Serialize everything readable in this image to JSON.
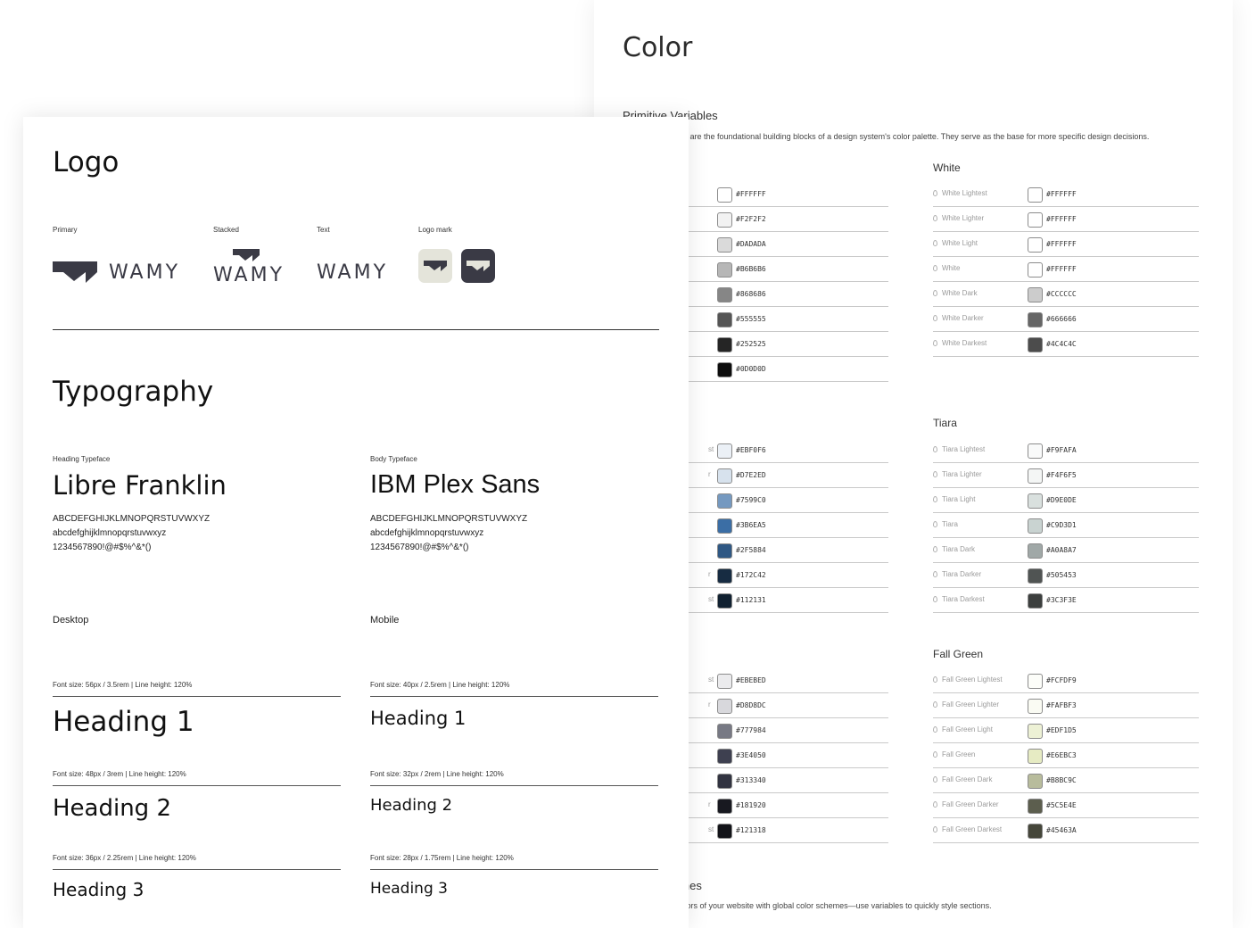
{
  "color_panel": {
    "title": "Color",
    "primitive_title": "Primitive Variables",
    "primitive_desc": "Primitive variables are the foundational building blocks of a design system's color palette. They serve as the base for more specific design decisions.",
    "schemes_title": "Color Schemes",
    "schemes_desc": "Customize the colors of your website with global color schemes—use variables to quickly style sections.",
    "left_groups": [
      {
        "rows": [
          {
            "name": "",
            "hex": "#FFFFFF"
          },
          {
            "name": "",
            "hex": "#F2F2F2"
          },
          {
            "name": "",
            "hex": "#DADADA"
          },
          {
            "name": "",
            "hex": "#B6B6B6"
          },
          {
            "name": "",
            "hex": "#868686"
          },
          {
            "name": "",
            "hex": "#555555"
          },
          {
            "name": "",
            "hex": "#252525"
          },
          {
            "name": "",
            "hex": "#0D0D0D"
          }
        ]
      },
      {
        "rows": [
          {
            "name": "st",
            "hex": "#EBF0F6"
          },
          {
            "name": "r",
            "hex": "#D7E2ED"
          },
          {
            "name": "",
            "hex": "#7599C0"
          },
          {
            "name": "",
            "hex": "#3B6EA5"
          },
          {
            "name": "",
            "hex": "#2F5884"
          },
          {
            "name": "r",
            "hex": "#172C42"
          },
          {
            "name": "st",
            "hex": "#112131"
          }
        ]
      },
      {
        "rows": [
          {
            "name": "st",
            "hex": "#EBEBED"
          },
          {
            "name": "r",
            "hex": "#D8D8DC"
          },
          {
            "name": "",
            "hex": "#777984"
          },
          {
            "name": "",
            "hex": "#3E4050"
          },
          {
            "name": "",
            "hex": "#313340"
          },
          {
            "name": "r",
            "hex": "#181920"
          },
          {
            "name": "st",
            "hex": "#121318"
          }
        ]
      }
    ],
    "right_groups": [
      {
        "title": "White",
        "rows": [
          {
            "name": "White Lightest",
            "hex": "#FFFFFF"
          },
          {
            "name": "White Lighter",
            "hex": "#FFFFFF"
          },
          {
            "name": "White Light",
            "hex": "#FFFFFF"
          },
          {
            "name": "White",
            "hex": "#FFFFFF"
          },
          {
            "name": "White Dark",
            "hex": "#CCCCCC"
          },
          {
            "name": "White Darker",
            "hex": "#666666"
          },
          {
            "name": "White Darkest",
            "hex": "#4C4C4C"
          }
        ]
      },
      {
        "title": "Tiara",
        "rows": [
          {
            "name": "Tiara Lightest",
            "hex": "#F9FAFA"
          },
          {
            "name": "Tiara Lighter",
            "hex": "#F4F6F5"
          },
          {
            "name": "Tiara Light",
            "hex": "#D9E0DE"
          },
          {
            "name": "Tiara",
            "hex": "#C9D3D1"
          },
          {
            "name": "Tiara Dark",
            "hex": "#A0A8A7"
          },
          {
            "name": "Tiara Darker",
            "hex": "#505453"
          },
          {
            "name": "Tiara Darkest",
            "hex": "#3C3F3E"
          }
        ]
      },
      {
        "title": "Fall Green",
        "rows": [
          {
            "name": "Fall Green Lightest",
            "hex": "#FCFDF9"
          },
          {
            "name": "Fall Green Lighter",
            "hex": "#FAFBF3"
          },
          {
            "name": "Fall Green Light",
            "hex": "#EDF1D5"
          },
          {
            "name": "Fall Green",
            "hex": "#E6EBC3"
          },
          {
            "name": "Fall Green Dark",
            "hex": "#B8BC9C"
          },
          {
            "name": "Fall Green Darker",
            "hex": "#5C5E4E"
          },
          {
            "name": "Fall Green Darkest",
            "hex": "#45463A"
          }
        ]
      }
    ]
  },
  "logo": {
    "title": "Logo",
    "primary_label": "Primary",
    "stacked_label": "Stacked",
    "text_label": "Text",
    "mark_label": "Logo mark",
    "wordmark": "WAMY",
    "mark_light_bg": "#E4E4DA",
    "mark_dark_bg": "#3A3A45",
    "brand_color": "#3A3A45"
  },
  "typography": {
    "title": "Typography",
    "heading_face_label": "Heading Typeface",
    "heading_face": "Libre Franklin",
    "body_face_label": "Body Typeface",
    "body_face": "IBM Plex Sans",
    "uppercase": "ABCDEFGHIJKLMNOPQRSTUVWXYZ",
    "lowercase": "abcdefghijklmnopqrstuvwxyz",
    "numbers": "1234567890!@#$%^&*()",
    "desktop": {
      "label": "Desktop",
      "h1_spec": "Font size: 56px / 3.5rem | Line height: 120%",
      "h1": "Heading 1",
      "h2_spec": "Font size: 48px / 3rem | Line height: 120%",
      "h2": "Heading 2",
      "h3_spec": "Font size: 36px / 2.25rem | Line height: 120%",
      "h3": "Heading 3"
    },
    "mobile": {
      "label": "Mobile",
      "h1_spec": "Font size: 40px / 2.5rem | Line height: 120%",
      "h1": "Heading 1",
      "h2_spec": "Font size: 32px / 2rem | Line height: 120%",
      "h2": "Heading 2",
      "h3_spec": "Font size: 28px / 1.75rem | Line height: 120%",
      "h3": "Heading 3"
    }
  }
}
